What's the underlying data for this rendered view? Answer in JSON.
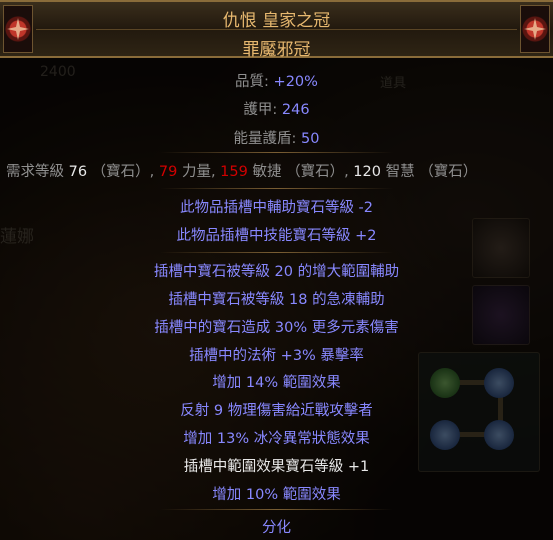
{
  "background": {
    "stash_value": "2400",
    "npc_name": "蓮娜",
    "panel_label": "道具"
  },
  "item": {
    "name": "仇恨 皇家之冠",
    "base_type": "罪魘邪冠",
    "properties": [
      {
        "label": "品質:",
        "value": "+20%"
      },
      {
        "label": "護甲:",
        "value": "246"
      },
      {
        "label": "能量護盾:",
        "value": "50"
      }
    ],
    "requirements": {
      "prefix": "需求等級",
      "level": "76",
      "gem1": "（寶石）",
      "str_value": "79",
      "str_label": "力量",
      "dex_value": "159",
      "dex_label": "敏捷",
      "gem2": "（寶石）",
      "int_value": "120",
      "int_label": "智慧",
      "gem3": "（寶石）"
    },
    "enchants": [
      "此物品插槽中輔助寶石等級 -2",
      "此物品插槽中技能寶石等級 +2"
    ],
    "explicit_mods": [
      "插槽中寶石被等級 20 的增大範圍輔助",
      "插槽中寶石被等級 18 的急凍輔助",
      "插槽中的寶石造成 30% 更多元素傷害",
      "插槽中的法術 +3% 暴擊率",
      "增加 14% 範圍效果",
      "反射 9 物理傷害給近戰攻擊者",
      "增加 13% 冰冷異常狀態效果",
      "插槽中範圍效果寶石等級 +1",
      "增加 10% 範圍效果"
    ],
    "status": "分化"
  },
  "colors": {
    "unique_name": "#e7b86f",
    "magic_blue": "#8888ff",
    "requirement_fail": "#d20000",
    "fractured": "#a29162"
  }
}
